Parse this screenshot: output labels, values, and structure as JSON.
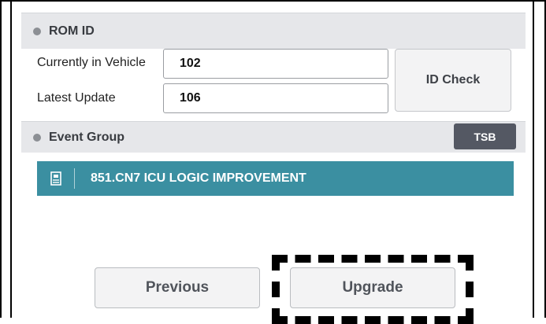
{
  "rom_id": {
    "header": "ROM ID",
    "currently_label": "Currently in Vehicle",
    "currently_value": "102",
    "latest_label": "Latest Update",
    "latest_value": "106",
    "id_check_label": "ID Check"
  },
  "event_group": {
    "header": "Event Group",
    "tsb_label": "TSB",
    "items": [
      {
        "label": "851.CN7 ICU LOGIC IMPROVEMENT",
        "icon": "document-icon"
      }
    ]
  },
  "footer": {
    "previous_label": "Previous",
    "upgrade_label": "Upgrade"
  },
  "colors": {
    "header_bg": "#e6e7ea",
    "event_row_bg": "#3b8fa1",
    "tsb_bg": "#545863"
  }
}
